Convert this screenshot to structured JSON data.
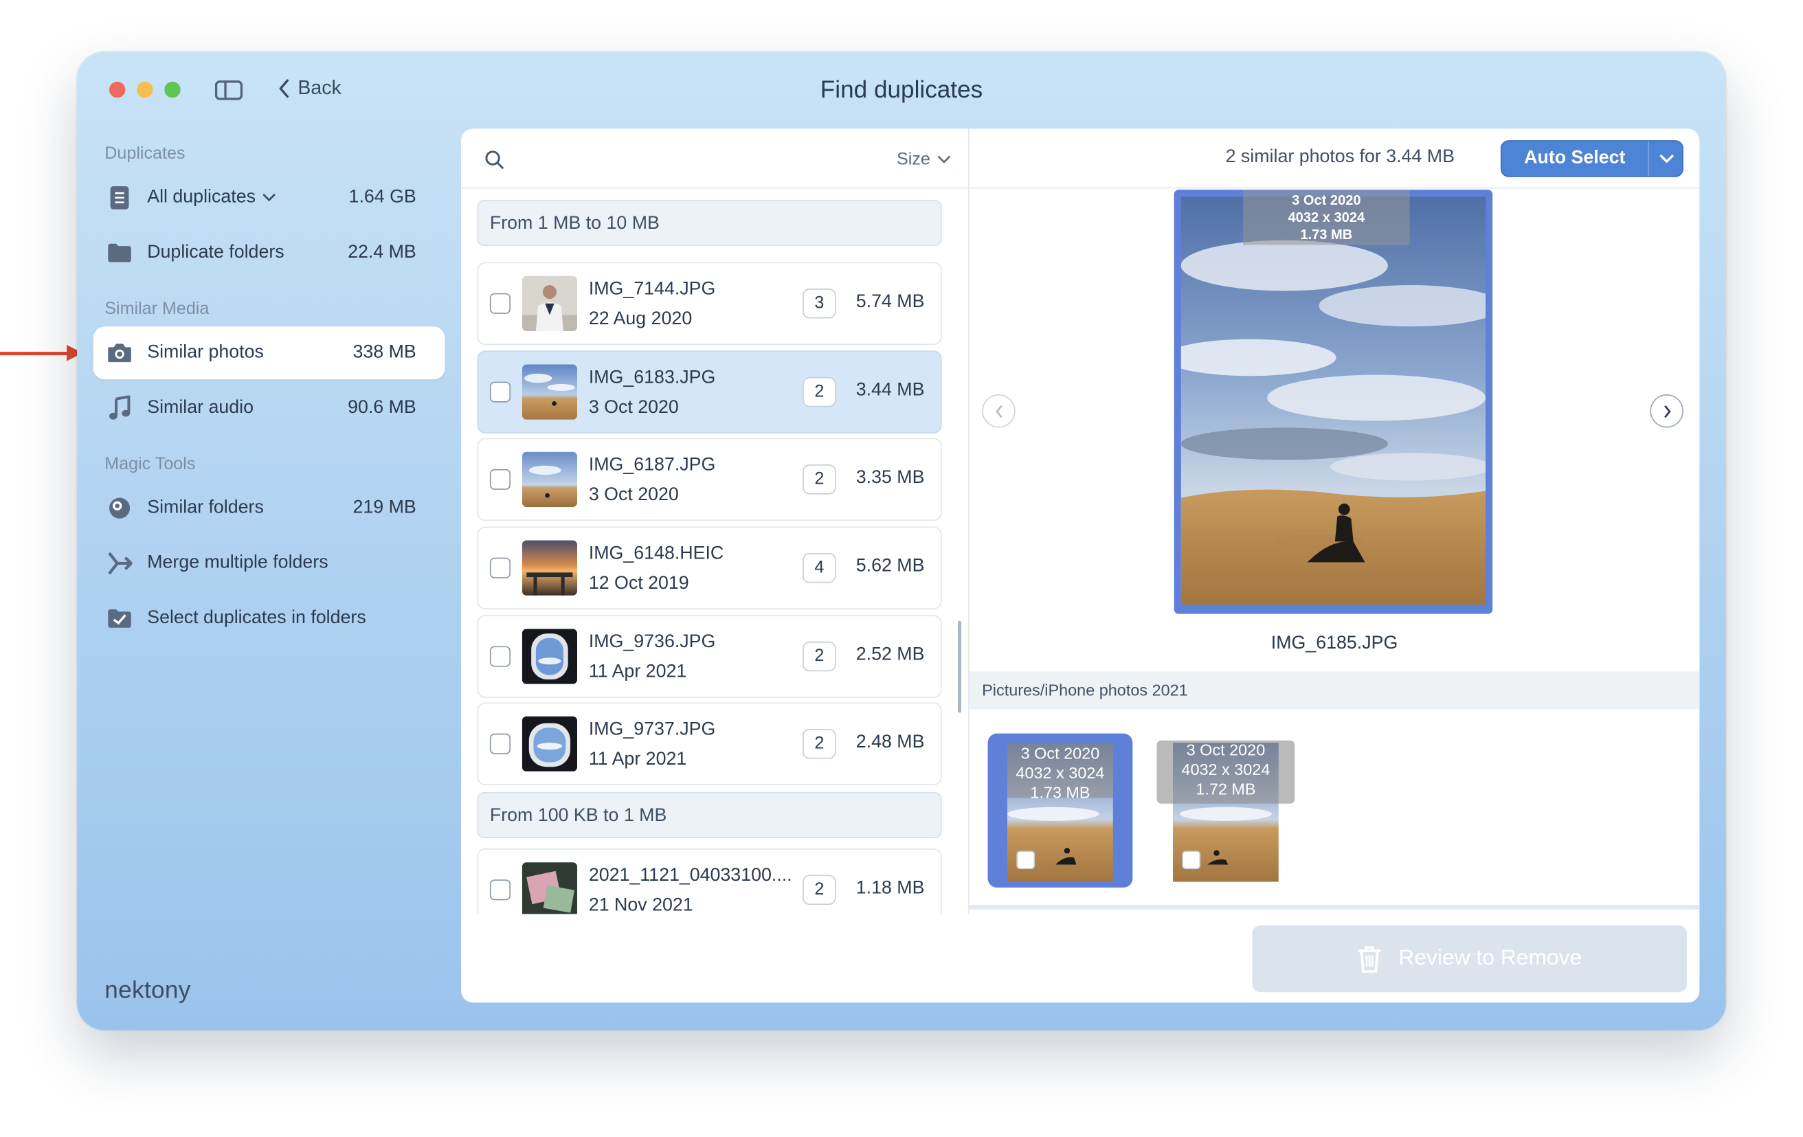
{
  "window": {
    "title": "Find duplicates",
    "back_label": "Back",
    "logo": "nektony"
  },
  "sidebar": {
    "sections": [
      {
        "title": "Duplicates"
      },
      {
        "title": "Similar Media"
      },
      {
        "title": "Magic Tools"
      }
    ],
    "items": [
      {
        "label": "All duplicates",
        "size": "1.64 GB",
        "icon": "list-icon"
      },
      {
        "label": "Duplicate folders",
        "size": "22.4 MB",
        "icon": "folder-icon"
      },
      {
        "label": "Similar photos",
        "size": "338 MB",
        "icon": "camera-icon",
        "active": true
      },
      {
        "label": "Similar audio",
        "size": "90.6 MB",
        "icon": "music-note-icon"
      },
      {
        "label": "Similar folders",
        "size": "219 MB",
        "icon": "similar-folders-icon"
      },
      {
        "label": "Merge multiple folders",
        "size": "",
        "icon": "merge-icon"
      },
      {
        "label": "Select duplicates in folders",
        "size": "",
        "icon": "checkbox-folder-icon"
      }
    ]
  },
  "list": {
    "sort_label": "Size",
    "groups": [
      {
        "label": "From 1 MB to 10 MB"
      },
      {
        "label": "From 100 KB to 1 MB"
      }
    ],
    "rows": [
      {
        "name": "IMG_7144.JPG",
        "date": "22 Aug 2020",
        "count": "3",
        "size": "5.74 MB"
      },
      {
        "name": "IMG_6183.JPG",
        "date": "3 Oct 2020",
        "count": "2",
        "size": "3.44 MB",
        "selected": true
      },
      {
        "name": "IMG_6187.JPG",
        "date": "3 Oct 2020",
        "count": "2",
        "size": "3.35 MB"
      },
      {
        "name": "IMG_6148.HEIC",
        "date": "12 Oct 2019",
        "count": "4",
        "size": "5.62 MB"
      },
      {
        "name": "IMG_9736.JPG",
        "date": "11 Apr 2021",
        "count": "2",
        "size": "2.52 MB"
      },
      {
        "name": "IMG_9737.JPG",
        "date": "11 Apr 2021",
        "count": "2",
        "size": "2.48 MB"
      },
      {
        "name": "2021_1121_04033100....",
        "date": "21 Nov 2021",
        "count": "2",
        "size": "1.18 MB"
      }
    ]
  },
  "detail": {
    "summary": "2 similar photos for 3.44 MB",
    "auto_select_label": "Auto Select",
    "preview": {
      "date": "3 Oct 2020",
      "dimensions": "4032 x 3024",
      "size": "1.73 MB",
      "filename": "IMG_6185.JPG"
    },
    "path": "Pictures/iPhone photos 2021",
    "thumbs": [
      {
        "date": "3 Oct 2020",
        "dimensions": "4032 x 3024",
        "size": "1.73 MB",
        "selected": true
      },
      {
        "date": "3 Oct 2020",
        "dimensions": "4032 x 3024",
        "size": "1.72 MB",
        "selected": false
      }
    ],
    "review_label": "Review to Remove"
  },
  "colors": {
    "accent": "#4d84d6",
    "selection": "#5e80d8",
    "annotation_arrow": "#e0452b"
  }
}
